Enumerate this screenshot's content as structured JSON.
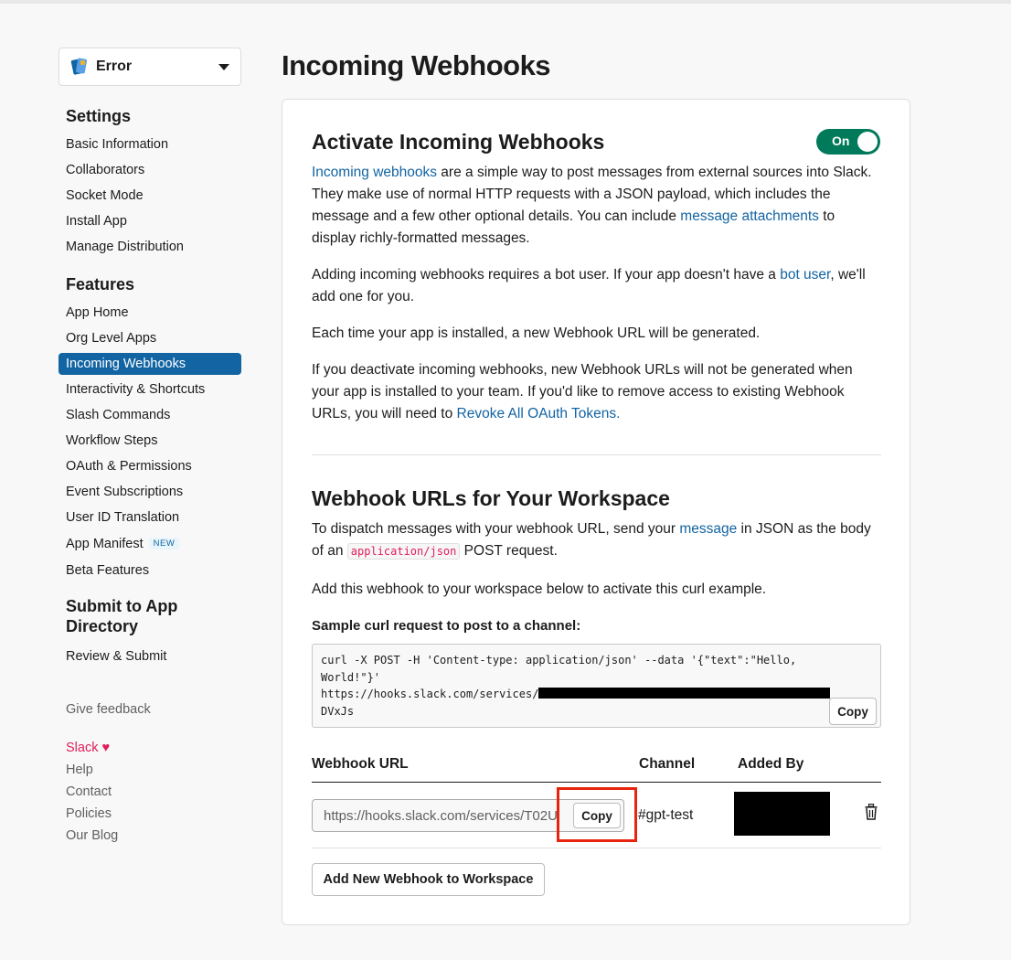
{
  "app_switcher": {
    "name": "Error"
  },
  "sidebar": {
    "settings_heading": "Settings",
    "settings_items": [
      "Basic Information",
      "Collaborators",
      "Socket Mode",
      "Install App",
      "Manage Distribution"
    ],
    "features_heading": "Features",
    "features_items": [
      "App Home",
      "Org Level Apps",
      "Incoming Webhooks",
      "Interactivity & Shortcuts",
      "Slash Commands",
      "Workflow Steps",
      "OAuth & Permissions",
      "Event Subscriptions",
      "User ID Translation",
      "App Manifest",
      "Beta Features"
    ],
    "new_badge": "NEW",
    "submit_heading": "Submit to App Directory",
    "submit_items": [
      "Review & Submit"
    ],
    "feedback": "Give feedback",
    "footer": {
      "slack": "Slack",
      "help": "Help",
      "contact": "Contact",
      "policies": "Policies",
      "blog": "Our Blog"
    }
  },
  "page": {
    "title": "Incoming Webhooks"
  },
  "activate": {
    "title": "Activate Incoming Webhooks",
    "toggle_label": "On",
    "p1_link": "Incoming webhooks",
    "p1_a": " are a simple way to post messages from external sources into Slack. They make use of normal HTTP requests with a JSON payload, which includes the message and a few other optional details. You can include ",
    "p1_link2": "message attachments",
    "p1_b": " to display richly-formatted messages.",
    "p2_a": "Adding incoming webhooks requires a bot user. If your app doesn't have a ",
    "p2_link": "bot user",
    "p2_b": ", we'll add one for you.",
    "p3": "Each time your app is installed, a new Webhook URL will be generated.",
    "p4_a": "If you deactivate incoming webhooks, new Webhook URLs will not be generated when your app is installed to your team. If you'd like to remove access to existing Webhook URLs, you will need to ",
    "p4_link": "Revoke All OAuth Tokens."
  },
  "workspace": {
    "title": "Webhook URLs for Your Workspace",
    "p1_a": "To dispatch messages with your webhook URL, send your ",
    "p1_link": "message",
    "p1_b": " in JSON as the body of an ",
    "p1_code": "application/json",
    "p1_c": " POST request.",
    "p2": "Add this webhook to your workspace below to activate this curl example.",
    "curl_label": "Sample curl request to post to a channel:",
    "curl_line1": "curl -X POST -H 'Content-type: application/json' --data '{\"text\":\"Hello,",
    "curl_line2": "World!\"}'",
    "curl_line3": "https://hooks.slack.com/services/",
    "curl_line4": "DVxJs",
    "copy_label": "Copy",
    "table_headers": {
      "url": "Webhook URL",
      "channel": "Channel",
      "added_by": "Added By"
    },
    "row": {
      "url": "https://hooks.slack.com/services/T02U",
      "channel": "#gpt-test",
      "copy_label": "Copy"
    },
    "add_button": "Add New Webhook to Workspace"
  }
}
